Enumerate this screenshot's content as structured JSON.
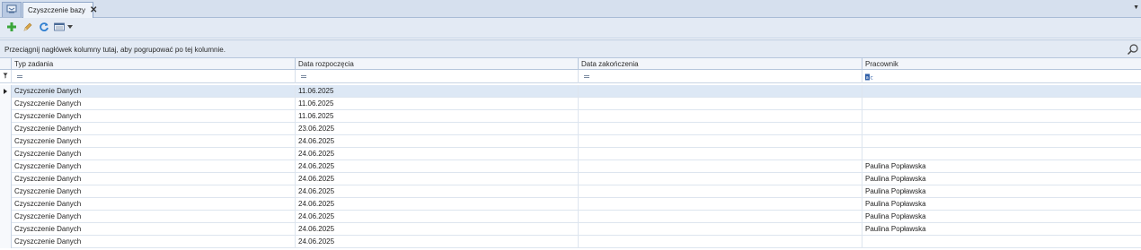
{
  "tabs": {
    "home_icon": "home-tab-icon",
    "active_label": "Czyszczenie bazy",
    "close_glyph": "✕",
    "menu_glyph": "▼"
  },
  "toolbar": {
    "buttons": [
      "add-icon",
      "edit-icon",
      "refresh-icon",
      "view-icon",
      "dropdown-arrow-icon"
    ]
  },
  "group_panel": {
    "text": "Przeciągnij nagłówek kolumny tutaj, aby pogrupować po tej kolumnie."
  },
  "grid": {
    "columns": [
      {
        "label": "Typ zadania"
      },
      {
        "label": "Data rozpoczęcia"
      },
      {
        "label": "Data zakończenia"
      },
      {
        "label": "Pracownik"
      }
    ],
    "rows": [
      {
        "typ": "Czyszczenie Danych",
        "start": "11.06.2025",
        "end": "",
        "worker": ""
      },
      {
        "typ": "Czyszczenie Danych",
        "start": "11.06.2025",
        "end": "",
        "worker": ""
      },
      {
        "typ": "Czyszczenie Danych",
        "start": "11.06.2025",
        "end": "",
        "worker": ""
      },
      {
        "typ": "Czyszczenie Danych",
        "start": "23.06.2025",
        "end": "",
        "worker": ""
      },
      {
        "typ": "Czyszczenie Danych",
        "start": "24.06.2025",
        "end": "",
        "worker": ""
      },
      {
        "typ": "Czyszczenie Danych",
        "start": "24.06.2025",
        "end": "",
        "worker": ""
      },
      {
        "typ": "Czyszczenie Danych",
        "start": "24.06.2025",
        "end": "",
        "worker": "Paulina Popławska"
      },
      {
        "typ": "Czyszczenie Danych",
        "start": "24.06.2025",
        "end": "",
        "worker": "Paulina Popławska"
      },
      {
        "typ": "Czyszczenie Danych",
        "start": "24.06.2025",
        "end": "",
        "worker": "Paulina Popławska"
      },
      {
        "typ": "Czyszczenie Danych",
        "start": "24.06.2025",
        "end": "",
        "worker": "Paulina Popławska"
      },
      {
        "typ": "Czyszczenie Danych",
        "start": "24.06.2025",
        "end": "",
        "worker": "Paulina Popławska"
      },
      {
        "typ": "Czyszczenie Danych",
        "start": "24.06.2025",
        "end": "",
        "worker": "Paulina Popławska"
      },
      {
        "typ": "Czyszczenie Danych",
        "start": "24.06.2025",
        "end": "",
        "worker": ""
      }
    ]
  },
  "colors": {
    "accent": "#2f7fd0",
    "add_green": "#3aa63a",
    "selected_row": "#dde8f5"
  }
}
